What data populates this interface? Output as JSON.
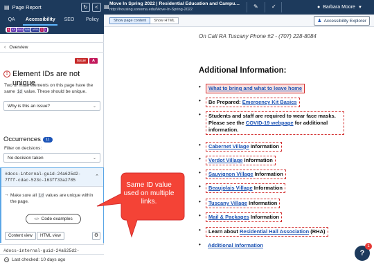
{
  "topbar": {
    "report_title": "Page Report",
    "page_title": "Move In Spring 2022 | Residential Education and Campus H...",
    "page_url": "http://housing.sonoma.edu/Move-In-Spring-2022",
    "user_name": "Barbara Moore"
  },
  "tabs": [
    "QA",
    "Accessibility",
    "SEO",
    "Policy"
  ],
  "standards": [
    "A",
    "AA",
    "AAA",
    "WAI",
    "ARIA",
    "C",
    "L"
  ],
  "panel": {
    "overview_label": "Overview",
    "issue_badge": "Issue",
    "level_badge": "A",
    "error_title": "Element IDs are not unique",
    "error_desc_1": "Two or more elements on this page have the same ",
    "error_desc_code": "id",
    "error_desc_2": " value. These should be unique.",
    "why_dropdown": "Why is this an issue?",
    "occurrences_label": "Occurrences",
    "occurrences_count": "11",
    "filter_label": "Filter on decisions:",
    "decision_dropdown": "No decision taken",
    "instance_guid": "#docs-internal-guid-24a625d2-7fff-cdac-523c-163ff33a2785",
    "instruction_1": "Make sure all ",
    "instruction_code": "id",
    "instruction_2": " values are unique within the page.",
    "code_examples_label": "Code examples",
    "content_view_label": "Content view",
    "html_view_label": "HTML view",
    "instance2_guid": "#docs-internal-guid-24a625d2-7fff-cdac-523c-163ff33a2785",
    "last_checked": "Last checked: 10 days ago"
  },
  "preview": {
    "show_content_label": "Show page content",
    "show_html_label": "Show HTML",
    "explorer_label": "Accessibility Explorer",
    "oncall": "On Call RA Tuscany Phone #2 - (707) 228-8084",
    "heading": "Additional Information:",
    "items": [
      {
        "pre": "",
        "link": "What to bring and what to leave home",
        "post": ""
      },
      {
        "pre": "Be Prepared: ",
        "link": "Emergency Kit Basics",
        "post": ""
      },
      {
        "pre": "Students and staff are required to wear face masks. Please see the ",
        "link": "COVID-19 webpage",
        "post": " for additional information."
      },
      {
        "pre": "",
        "link": "Cabernet Village",
        "post": " Information"
      },
      {
        "pre": "",
        "link": "Verdot Village",
        "post": " Information"
      },
      {
        "pre": "",
        "link": "Sauvignon Village",
        "post": " Information"
      },
      {
        "pre": "",
        "link": "Beaujolais Village",
        "post": " Information"
      },
      {
        "pre": "",
        "link": "Tuscany Village",
        "post": " Information"
      },
      {
        "pre": "",
        "link": "Mail & Packages",
        "post": " Information"
      },
      {
        "pre": "Learn about ",
        "link": "Residential Hall Association",
        "post": " (RHA)"
      },
      {
        "pre": "",
        "link": "Additional Information",
        "post": ""
      }
    ],
    "callout_text": "Same ID value used on multiple links."
  },
  "help": {
    "label": "?",
    "badge": "1"
  },
  "colors": {
    "navy": "#1d3a5c",
    "alert": "#d32f2f",
    "link": "#1e54b4",
    "callout": "#f44336"
  }
}
